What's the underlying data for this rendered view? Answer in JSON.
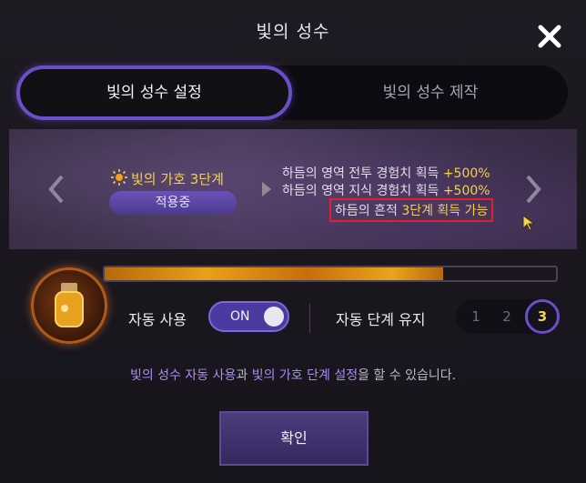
{
  "window": {
    "title": "빛의 성수"
  },
  "tabs": [
    {
      "label": "빛의 성수 설정",
      "active": true
    },
    {
      "label": "빛의 성수 제작",
      "active": false
    }
  ],
  "blessing": {
    "title": "빛의 가호 3단계",
    "status_badge": "적용중",
    "effects": [
      {
        "text": "하듬의 영역 전투 경험치 획득 ",
        "value": "+500%"
      },
      {
        "text": "하듬의 영역 지식 경험치 획득 ",
        "value": "+500%"
      },
      {
        "text": "하듬의 흔적 ",
        "value": "3단계 획득 가능"
      }
    ]
  },
  "progress": {
    "fill_fraction": 0.75
  },
  "auto_use": {
    "label": "자동 사용",
    "toggle_text": "ON"
  },
  "auto_stage": {
    "label": "자동 단계 유지",
    "stages": [
      "1",
      "2",
      "3"
    ],
    "selected": "3"
  },
  "hint": {
    "part1": "빛의 성수 자동 사용",
    "part2": "과 ",
    "part3": "빛의 가호 단계 설정",
    "part4": "을 할 수 있습니다."
  },
  "confirm_label": "확인",
  "colors": {
    "accent": "#6a4fc8",
    "highlight": "#f3d24c",
    "hint_purple": "#a88cf0"
  }
}
